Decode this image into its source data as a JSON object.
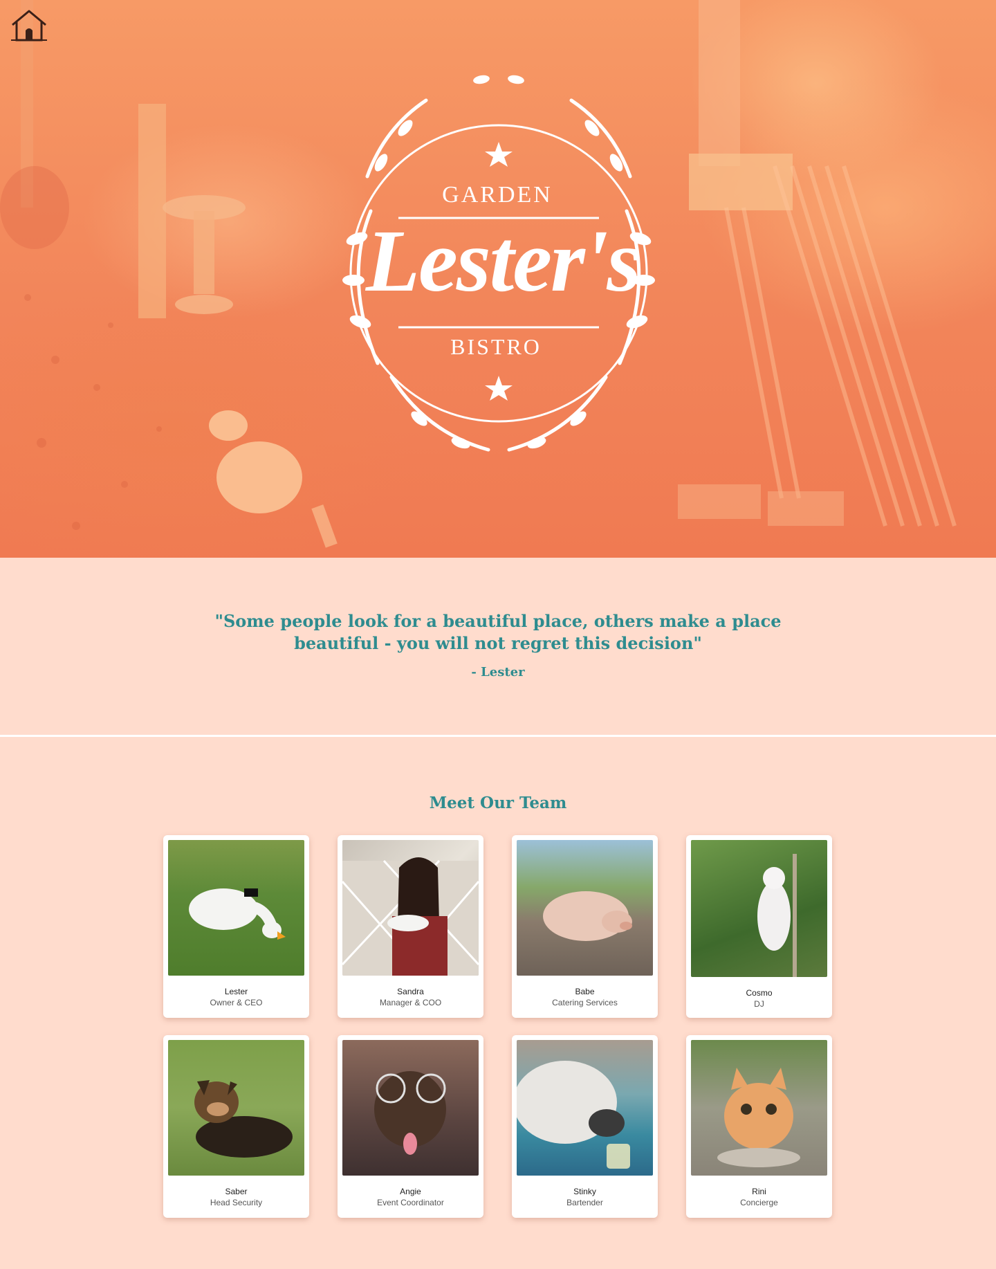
{
  "nav": {
    "home_icon": "house-icon"
  },
  "hero": {
    "logo": {
      "top_word": "GARDEN",
      "name": "Lester's",
      "bottom_word": "BISTRO"
    }
  },
  "quote": {
    "text": "\"Some people look for a beautiful place, others make a place beautiful - you will not regret this decision\"",
    "author": "- Lester"
  },
  "team": {
    "title": "Meet Our Team",
    "members": [
      {
        "name": "Lester",
        "role": "Owner & CEO"
      },
      {
        "name": "Sandra",
        "role": "Manager & COO"
      },
      {
        "name": "Babe",
        "role": "Catering Services"
      },
      {
        "name": "Cosmo",
        "role": "DJ"
      },
      {
        "name": "Saber",
        "role": "Head Security"
      },
      {
        "name": "Angie",
        "role": "Event Coordinator"
      },
      {
        "name": "Stinky",
        "role": "Bartender"
      },
      {
        "name": "Rini",
        "role": "Concierge"
      }
    ]
  },
  "colors": {
    "accent": "#2e8c8f",
    "page_background": "#ffdccd",
    "hero_tint": "#f2855a"
  }
}
